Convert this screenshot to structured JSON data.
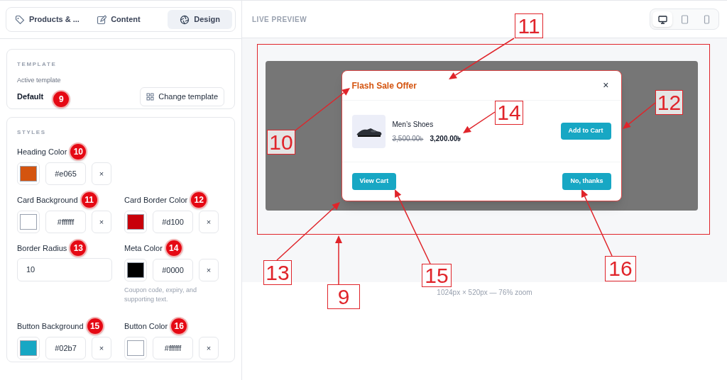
{
  "tabs": [
    {
      "label": "Products & ...",
      "selected": false
    },
    {
      "label": "Content",
      "selected": false
    },
    {
      "label": "Design",
      "selected": true
    }
  ],
  "template": {
    "section_title": "TEMPLATE",
    "caption": "Active template",
    "value": "Default",
    "badge": "9",
    "button": "Change template"
  },
  "styles": {
    "section_title": "STYLES",
    "fields": [
      {
        "kind": "color",
        "label": "Heading Color",
        "badge": "10",
        "color": "#d4540f",
        "value": "#e065",
        "clear": "×"
      },
      {
        "kind": "color",
        "label": "Card Background",
        "badge": "11",
        "color": "#ffffff",
        "value": "#ffffff",
        "clear": "×"
      },
      {
        "kind": "color",
        "label": "Card Border Color",
        "badge": "12",
        "color": "#c8000a",
        "value": "#d100",
        "clear": "×"
      },
      {
        "kind": "number",
        "label": "Border Radius",
        "badge": "13",
        "value": "10"
      },
      {
        "kind": "color",
        "label": "Meta Color",
        "badge": "14",
        "color": "#000000",
        "value": "#0000",
        "clear": "×",
        "help": "Coupon code, expiry, and supporting text."
      },
      {
        "kind": "color",
        "label": "Button Background",
        "badge": "15",
        "color": "#17a7c4",
        "value": "#02b7",
        "clear": "×"
      },
      {
        "kind": "color",
        "label": "Button Color",
        "badge": "16",
        "color": "#ffffff",
        "value": "#ffffff",
        "clear": "×"
      }
    ]
  },
  "preview": {
    "header": "LIVE PREVIEW",
    "devices": [
      {
        "selected": true
      },
      {
        "selected": false
      },
      {
        "selected": false
      }
    ],
    "popup": {
      "title": "Flash Sale Offer",
      "close": "×",
      "product": {
        "name": "Men’s Shoes",
        "old_price": "3,500.00৳",
        "price": "3,200.00৳",
        "button": "Add to Cart"
      },
      "footer_buttons": [
        "View Cart",
        "No, thanks"
      ]
    },
    "caption": "1024px × 520px — 76% zoom"
  },
  "callouts": [
    {
      "number": "11"
    },
    {
      "number": "12"
    },
    {
      "number": "10"
    },
    {
      "number": "14"
    },
    {
      "number": "13"
    },
    {
      "number": "9"
    },
    {
      "number": "15"
    },
    {
      "number": "16"
    }
  ]
}
